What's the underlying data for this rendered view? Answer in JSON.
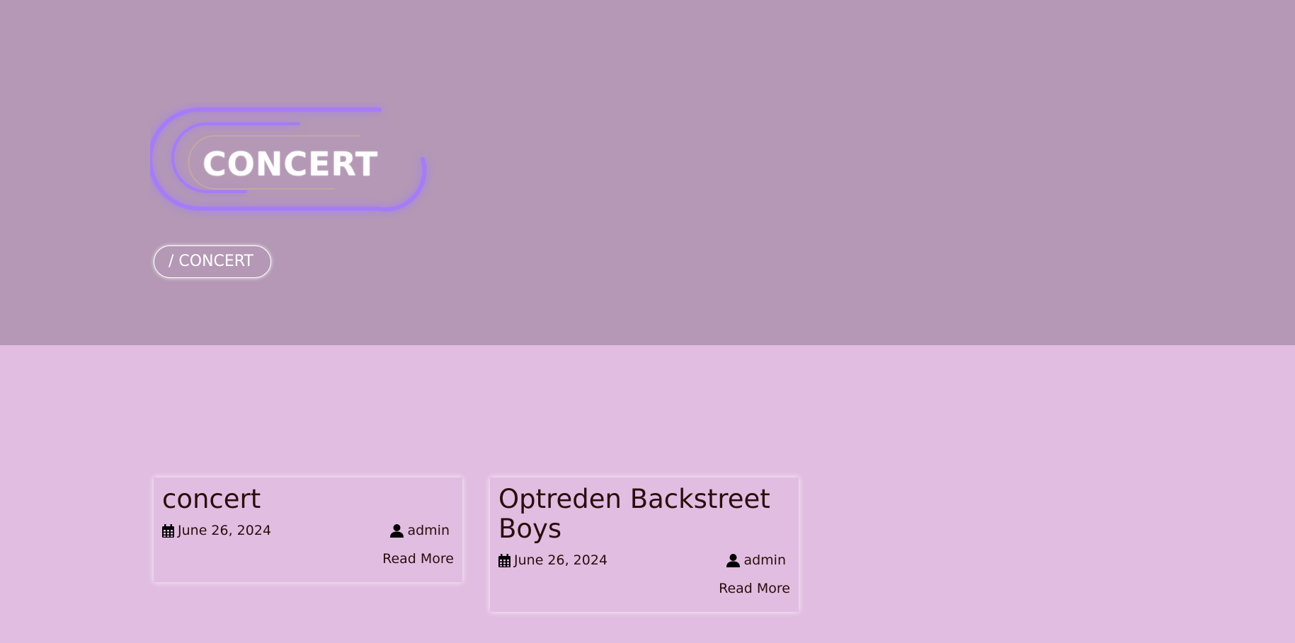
{
  "hero": {
    "logo_text": "CONCERT",
    "breadcrumb": "/ CONCERT"
  },
  "posts": [
    {
      "title": "concert",
      "date": "June 26, 2024",
      "author": "admin",
      "read_more": "Read More"
    },
    {
      "title": "Optreden Backstreet Boys",
      "date": "June 26, 2024",
      "author": "admin",
      "read_more": "Read More"
    }
  ],
  "icons": {
    "date": "calendar-icon",
    "author": "user-icon"
  },
  "colors": {
    "hero_bg": "#b498b5",
    "page_bg": "#e1bde1",
    "logo_glow": "#a57cf7",
    "text": "#2a0d0d"
  }
}
